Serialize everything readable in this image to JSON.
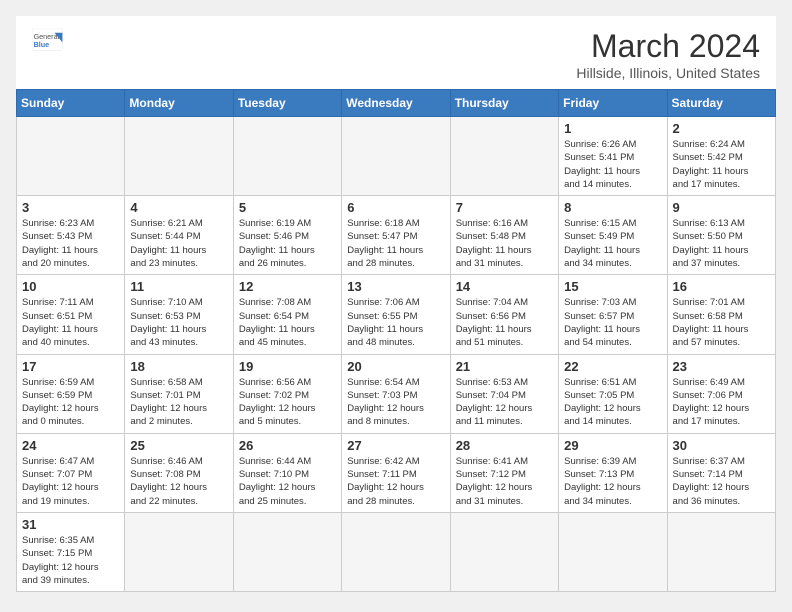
{
  "header": {
    "logo_general": "General",
    "logo_blue": "Blue",
    "title": "March 2024",
    "location": "Hillside, Illinois, United States"
  },
  "weekdays": [
    "Sunday",
    "Monday",
    "Tuesday",
    "Wednesday",
    "Thursday",
    "Friday",
    "Saturday"
  ],
  "weeks": [
    [
      {
        "day": "",
        "info": ""
      },
      {
        "day": "",
        "info": ""
      },
      {
        "day": "",
        "info": ""
      },
      {
        "day": "",
        "info": ""
      },
      {
        "day": "",
        "info": ""
      },
      {
        "day": "1",
        "info": "Sunrise: 6:26 AM\nSunset: 5:41 PM\nDaylight: 11 hours\nand 14 minutes."
      },
      {
        "day": "2",
        "info": "Sunrise: 6:24 AM\nSunset: 5:42 PM\nDaylight: 11 hours\nand 17 minutes."
      }
    ],
    [
      {
        "day": "3",
        "info": "Sunrise: 6:23 AM\nSunset: 5:43 PM\nDaylight: 11 hours\nand 20 minutes."
      },
      {
        "day": "4",
        "info": "Sunrise: 6:21 AM\nSunset: 5:44 PM\nDaylight: 11 hours\nand 23 minutes."
      },
      {
        "day": "5",
        "info": "Sunrise: 6:19 AM\nSunset: 5:46 PM\nDaylight: 11 hours\nand 26 minutes."
      },
      {
        "day": "6",
        "info": "Sunrise: 6:18 AM\nSunset: 5:47 PM\nDaylight: 11 hours\nand 28 minutes."
      },
      {
        "day": "7",
        "info": "Sunrise: 6:16 AM\nSunset: 5:48 PM\nDaylight: 11 hours\nand 31 minutes."
      },
      {
        "day": "8",
        "info": "Sunrise: 6:15 AM\nSunset: 5:49 PM\nDaylight: 11 hours\nand 34 minutes."
      },
      {
        "day": "9",
        "info": "Sunrise: 6:13 AM\nSunset: 5:50 PM\nDaylight: 11 hours\nand 37 minutes."
      }
    ],
    [
      {
        "day": "10",
        "info": "Sunrise: 7:11 AM\nSunset: 6:51 PM\nDaylight: 11 hours\nand 40 minutes."
      },
      {
        "day": "11",
        "info": "Sunrise: 7:10 AM\nSunset: 6:53 PM\nDaylight: 11 hours\nand 43 minutes."
      },
      {
        "day": "12",
        "info": "Sunrise: 7:08 AM\nSunset: 6:54 PM\nDaylight: 11 hours\nand 45 minutes."
      },
      {
        "day": "13",
        "info": "Sunrise: 7:06 AM\nSunset: 6:55 PM\nDaylight: 11 hours\nand 48 minutes."
      },
      {
        "day": "14",
        "info": "Sunrise: 7:04 AM\nSunset: 6:56 PM\nDaylight: 11 hours\nand 51 minutes."
      },
      {
        "day": "15",
        "info": "Sunrise: 7:03 AM\nSunset: 6:57 PM\nDaylight: 11 hours\nand 54 minutes."
      },
      {
        "day": "16",
        "info": "Sunrise: 7:01 AM\nSunset: 6:58 PM\nDaylight: 11 hours\nand 57 minutes."
      }
    ],
    [
      {
        "day": "17",
        "info": "Sunrise: 6:59 AM\nSunset: 6:59 PM\nDaylight: 12 hours\nand 0 minutes."
      },
      {
        "day": "18",
        "info": "Sunrise: 6:58 AM\nSunset: 7:01 PM\nDaylight: 12 hours\nand 2 minutes."
      },
      {
        "day": "19",
        "info": "Sunrise: 6:56 AM\nSunset: 7:02 PM\nDaylight: 12 hours\nand 5 minutes."
      },
      {
        "day": "20",
        "info": "Sunrise: 6:54 AM\nSunset: 7:03 PM\nDaylight: 12 hours\nand 8 minutes."
      },
      {
        "day": "21",
        "info": "Sunrise: 6:53 AM\nSunset: 7:04 PM\nDaylight: 12 hours\nand 11 minutes."
      },
      {
        "day": "22",
        "info": "Sunrise: 6:51 AM\nSunset: 7:05 PM\nDaylight: 12 hours\nand 14 minutes."
      },
      {
        "day": "23",
        "info": "Sunrise: 6:49 AM\nSunset: 7:06 PM\nDaylight: 12 hours\nand 17 minutes."
      }
    ],
    [
      {
        "day": "24",
        "info": "Sunrise: 6:47 AM\nSunset: 7:07 PM\nDaylight: 12 hours\nand 19 minutes."
      },
      {
        "day": "25",
        "info": "Sunrise: 6:46 AM\nSunset: 7:08 PM\nDaylight: 12 hours\nand 22 minutes."
      },
      {
        "day": "26",
        "info": "Sunrise: 6:44 AM\nSunset: 7:10 PM\nDaylight: 12 hours\nand 25 minutes."
      },
      {
        "day": "27",
        "info": "Sunrise: 6:42 AM\nSunset: 7:11 PM\nDaylight: 12 hours\nand 28 minutes."
      },
      {
        "day": "28",
        "info": "Sunrise: 6:41 AM\nSunset: 7:12 PM\nDaylight: 12 hours\nand 31 minutes."
      },
      {
        "day": "29",
        "info": "Sunrise: 6:39 AM\nSunset: 7:13 PM\nDaylight: 12 hours\nand 34 minutes."
      },
      {
        "day": "30",
        "info": "Sunrise: 6:37 AM\nSunset: 7:14 PM\nDaylight: 12 hours\nand 36 minutes."
      }
    ],
    [
      {
        "day": "31",
        "info": "Sunrise: 6:35 AM\nSunset: 7:15 PM\nDaylight: 12 hours\nand 39 minutes."
      },
      {
        "day": "",
        "info": ""
      },
      {
        "day": "",
        "info": ""
      },
      {
        "day": "",
        "info": ""
      },
      {
        "day": "",
        "info": ""
      },
      {
        "day": "",
        "info": ""
      },
      {
        "day": "",
        "info": ""
      }
    ]
  ]
}
